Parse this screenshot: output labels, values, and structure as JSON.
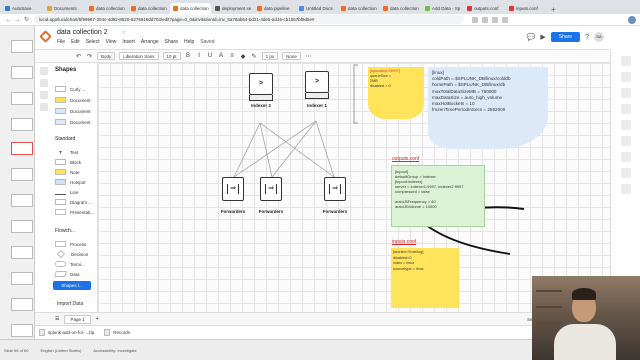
{
  "browser": {
    "tabs": [
      {
        "label": "AutoSave",
        "color": "#2b7cd3"
      },
      {
        "label": "Documents",
        "color": "#d9a441"
      },
      {
        "label": "data collection",
        "color": "#f06a22"
      },
      {
        "label": "data collection",
        "color": "#f06a22"
      },
      {
        "label": "data collection",
        "color": "#f06a22",
        "active": true
      },
      {
        "label": "deployment se",
        "color": "#555555"
      },
      {
        "label": "data pipeline",
        "color": "#f06a22"
      },
      {
        "label": "Untitled Docs",
        "color": "#4b8be8"
      },
      {
        "label": "data collection",
        "color": "#f06a22"
      },
      {
        "label": "data collection",
        "color": "#f06a22"
      },
      {
        "label": "Add Data - Sp",
        "color": "#6abf4b"
      },
      {
        "label": "outputs.conf",
        "color": "#d33"
      },
      {
        "label": "inputs.conf",
        "color": "#d33"
      }
    ],
    "new_tab": "+",
    "url": "lucid.app/lucidchart/5f99967-304c-4d92-8520-5276916dd703/edit?page=0_0&invitationId=inv_5a78ab64-bd21-4de5-ad15-cb1557bf9d5e#"
  },
  "lucid": {
    "doc_title": "data collection 2",
    "menus": [
      "File",
      "Edit",
      "Select",
      "View",
      "Insert",
      "Arrange",
      "Share",
      "Help"
    ],
    "saved": "Saved",
    "share_button": "Share",
    "avatar": "SA"
  },
  "toolbar": {
    "style": "Body",
    "font": "Liberation Sans",
    "font_size": "10 pt",
    "line_width": "1 px",
    "arrow_style": "None"
  },
  "shapes_panel": {
    "title": "Shapes",
    "recent": [
      {
        "label": "Curly ...",
        "color": "#ffffff"
      },
      {
        "label": "Document",
        "color": "#ffe35a"
      },
      {
        "label": "Document",
        "color": "#dbe9f8"
      },
      {
        "label": "Document",
        "color": "#dbe9f8"
      }
    ],
    "standard_section": "Standard",
    "standard": [
      "Text",
      "Block",
      "Note",
      "Hotspot",
      "Line",
      "Diagram ...",
      "Presentati..."
    ],
    "flowchart_section": "Flowch...",
    "flowchart": [
      "Process",
      "Decision",
      "Termi...",
      "Data"
    ],
    "import_button": "Shapes l...",
    "import_data": "Import Data"
  },
  "diagram": {
    "indexer_left_label": "Indexer 2",
    "indexer_right_label": "Indexer 1",
    "forwarders": [
      "Forwarders",
      "Forwarders",
      "Forwarders"
    ],
    "yellow_top": [
      "[splunktcp://9997]",
      "queueSize =",
      "2MB",
      "disabled = 0"
    ],
    "blue_lines": [
      "[linux]",
      "coldPath = $SPLUNK_DB/linux/colddb",
      "homePath = $SPLUNK_DB/linux/db",
      "maxTotalDataSizeMB = 750000",
      "maxDataSize = auto_high_volume",
      "maxHotBuckets = 10",
      "frozenTimePeriodInSecs = 2592000"
    ],
    "outputs_label": "outputs.conf",
    "green_lines": [
      "[tcpout]",
      "defaultGroup = indexer",
      "[tcpout:indexer]",
      "server = indexer1:9997, indexer2:9997",
      "compressed = false",
      "",
      "autoLBFrequency = 40",
      "autoLBVolume = 10000"
    ],
    "inputs_label": "inputs.conf",
    "yellow_bottom": [
      "[monitor:///var/log]",
      "disabled=0",
      "index = linux",
      "sourcetype = linux"
    ]
  },
  "pagebar": {
    "page": "Page 1",
    "selected": "Selected objects"
  },
  "downloads": [
    {
      "label": "splunk-add-on-for-...zip"
    },
    {
      "label": "Records"
    }
  ],
  "statusbar": [
    "Slide 56 of 60",
    "English (United States)",
    "Accessibility: Investigate"
  ]
}
